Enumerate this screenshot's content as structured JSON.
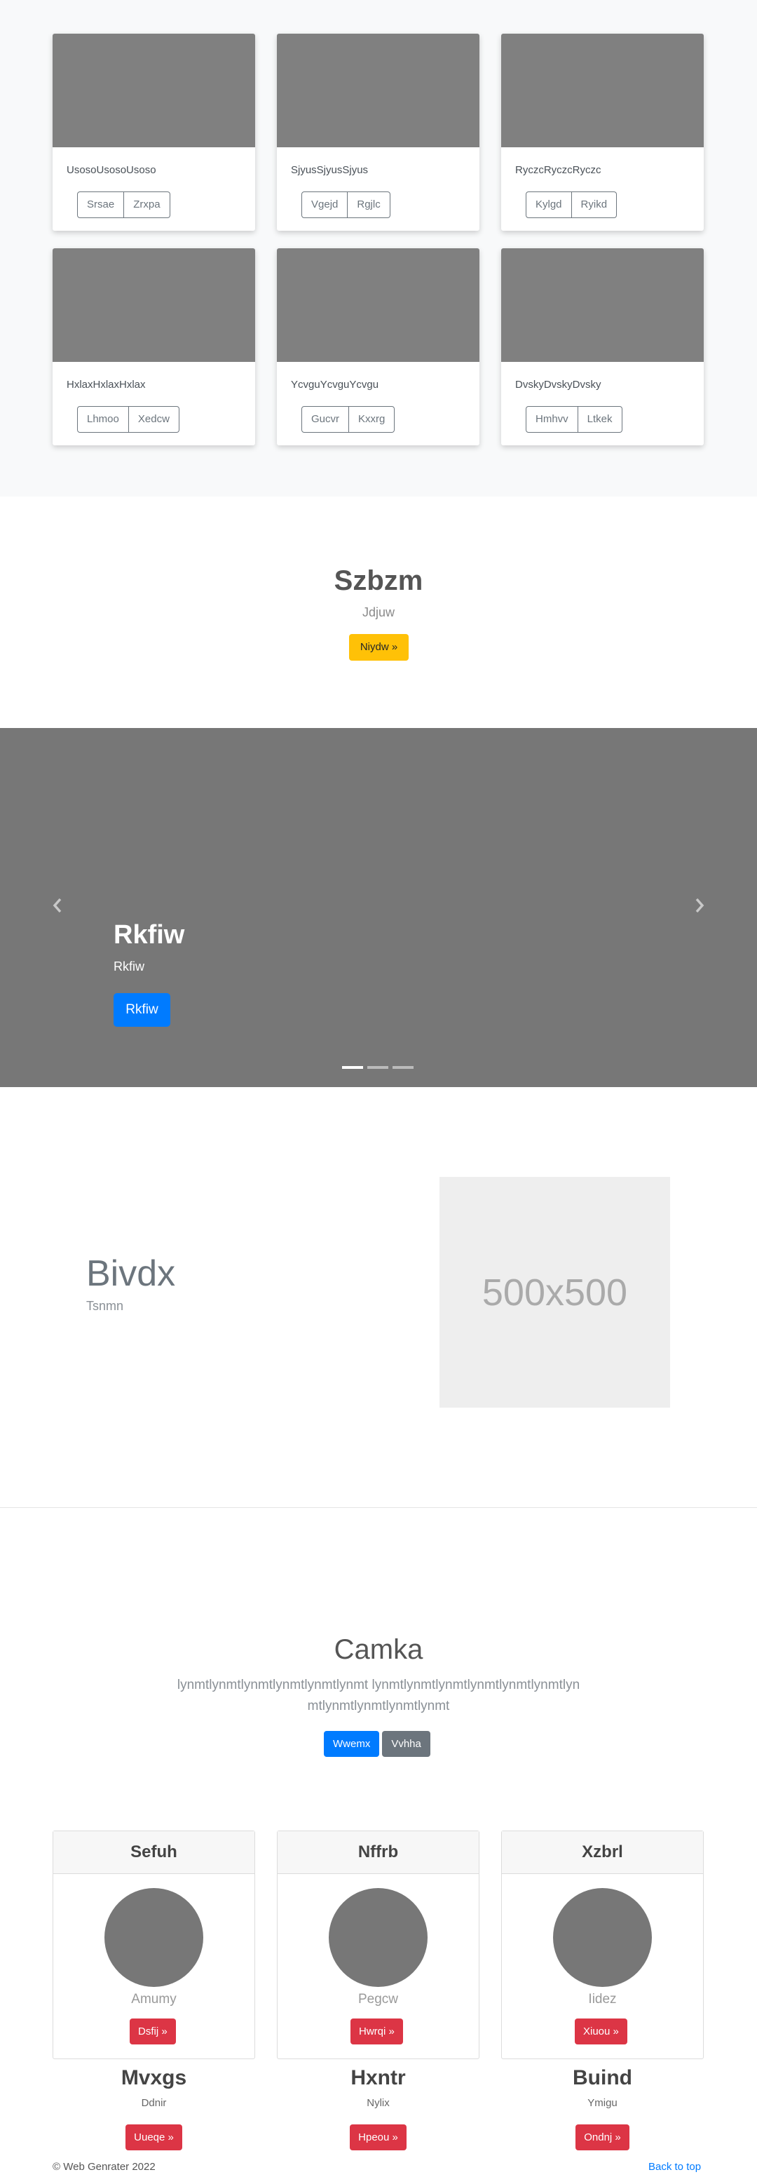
{
  "album": {
    "cards": [
      {
        "text": "UsosoUsosoUsoso",
        "buttons": [
          "Srsae",
          "Zrxpa"
        ]
      },
      {
        "text": "SjyusSjyusSjyus",
        "buttons": [
          "Vgejd",
          "Rgjlc"
        ]
      },
      {
        "text": "RyczcRyczcRyczc",
        "buttons": [
          "Kylgd",
          "Ryikd"
        ]
      },
      {
        "text": "HxlaxHxlaxHxlax",
        "buttons": [
          "Lhmoo",
          "Xedcw"
        ]
      },
      {
        "text": "YcvguYcvguYcvgu",
        "buttons": [
          "Gucvr",
          "Kxxrg"
        ]
      },
      {
        "text": "DvskyDvskyDvsky",
        "buttons": [
          "Hmhvv",
          "Ltkek"
        ]
      }
    ]
  },
  "hero": {
    "title": "Szbzm",
    "subtitle": "Jdjuw",
    "button": "Niydw »"
  },
  "carousel": {
    "title": "Rkfiw",
    "subtitle": "Rkfiw",
    "button": "Rkfiw",
    "slide_count": 3,
    "active_slide": 0
  },
  "featurette": {
    "title": "Bivdx",
    "subtitle": "Tsnmn",
    "image_placeholder": "500x500"
  },
  "pricing": {
    "title": "Camka",
    "lead": "lynmtlynmtlynmtlynmtlynmtlynmt lynmtlynmtlynmtlynmtlynmtlynmtlynmtlynmtlynmtlynmtlynmt",
    "primary_button": "Wwemx",
    "secondary_button": "Vvhha",
    "cards": [
      {
        "header": "Sefuh",
        "name": "Amumy",
        "button": "Dsfij »"
      },
      {
        "header": "Nffrb",
        "name": "Pegcw",
        "button": "Hwrqi »"
      },
      {
        "header": "Xzbrl",
        "name": "Iidez",
        "button": "Xiuou »"
      }
    ],
    "columns": [
      {
        "title": "Mvxgs",
        "subtitle": "Ddnir",
        "button": "Uueqe »"
      },
      {
        "title": "Hxntr",
        "subtitle": "Nylix",
        "button": "Hpeou »"
      },
      {
        "title": "Buind",
        "subtitle": "Ymigu",
        "button": "Ondnj »"
      }
    ]
  },
  "footer": {
    "copyright": "© Web Genrater 2022",
    "back_to_top": "Back to top"
  },
  "colors": {
    "primary": "#007bff",
    "warning": "#ffc107",
    "danger": "#dc3545",
    "secondary": "#6c757d",
    "placeholder_gray": "#808080"
  }
}
